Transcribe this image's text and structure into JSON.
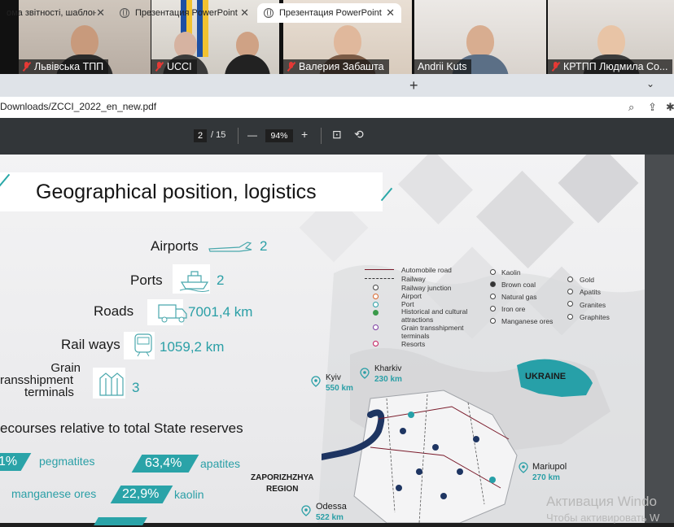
{
  "participants": [
    {
      "name": "Львівська ТПП",
      "muted": true
    },
    {
      "name": "UCCI",
      "muted": true
    },
    {
      "name": "Валерия Забашта",
      "muted": true
    },
    {
      "name": "Andrii Kuts",
      "muted": false
    },
    {
      "name": "КРТПП Людмила Со...",
      "muted": true
    }
  ],
  "browser": {
    "tabs": [
      {
        "label": "ома звітності, шаблони доку"
      },
      {
        "label": "Презентация PowerPoint"
      },
      {
        "label": "Презентация PowerPoint"
      }
    ],
    "url": "Downloads/ZCCI_2022_en_new.pdf"
  },
  "pdf": {
    "page": "2",
    "total": "/ 15",
    "zoom": "94%",
    "minus": "—",
    "plus": "+"
  },
  "slide": {
    "title": "Geographical position, logistics",
    "stats": [
      {
        "label": "Airports",
        "value": "2"
      },
      {
        "label": "Ports",
        "value": "2"
      },
      {
        "label": "Roads",
        "value": "7001,4 km"
      },
      {
        "label": "Rail ways",
        "value": "1059,2 km"
      },
      {
        "label_lines": [
          "Grain",
          "ransshipment",
          "terminals"
        ],
        "value": "3"
      }
    ],
    "resources_caption": "ecourses relative to total State reserves",
    "resources": [
      {
        "percent": "1%",
        "name": "pegmatites"
      },
      {
        "percent": "63,4%",
        "name": "apatites"
      },
      {
        "percent": "22,9%",
        "name": "kaolin",
        "prefix": "manganese ores"
      }
    ],
    "legend_left": [
      "Automobile road",
      "Railway",
      "Railway junction",
      "Airport",
      "Port",
      "Historical and cultural attractions",
      "Grain transshipment terminals",
      "Resorts"
    ],
    "legend_mid": [
      "Kaolin",
      "Brown coal",
      "Natural gas",
      "Iron ore",
      "Manganese ores"
    ],
    "legend_right": [
      "Gold",
      "Apatits",
      "Granites",
      "Graphites"
    ],
    "cities": [
      {
        "name": "Kyiv",
        "dist": "550 km"
      },
      {
        "name": "Kharkiv",
        "dist": "230 km"
      },
      {
        "name": "Mariupol",
        "dist": "270 km"
      },
      {
        "name": "Odessa",
        "dist": "522 km"
      }
    ],
    "region": [
      "ZAPORIZHZHYA",
      "REGION"
    ],
    "country": "UKRAINE"
  },
  "watermark": {
    "line1": "Активация Windo",
    "line2": "Чтобы активировать W"
  }
}
